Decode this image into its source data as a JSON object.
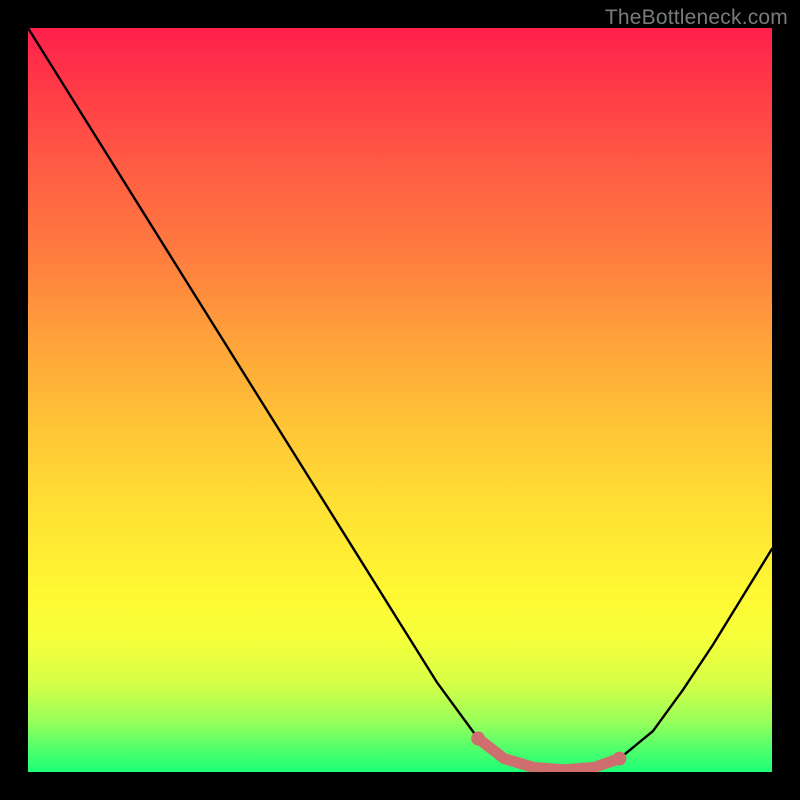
{
  "watermark": "TheBottleneck.com",
  "chart_data": {
    "type": "line",
    "title": "",
    "xlabel": "",
    "ylabel": "",
    "xlim": [
      0,
      100
    ],
    "ylim": [
      0,
      100
    ],
    "grid": false,
    "series": [
      {
        "name": "bottleneck-curve",
        "x": [
          0,
          5,
          10,
          15,
          20,
          25,
          30,
          35,
          40,
          45,
          50,
          55,
          60.5,
          64,
          68,
          72,
          76,
          79.5,
          84,
          88,
          92,
          96,
          100
        ],
        "values": [
          100,
          92,
          84,
          76,
          68,
          60,
          52,
          44,
          36,
          28,
          20,
          12,
          4.5,
          1.8,
          0.6,
          0.3,
          0.6,
          1.8,
          5.5,
          11,
          17,
          23.5,
          30
        ],
        "color": "#000000"
      },
      {
        "name": "optimal-region-highlight",
        "x": [
          60.5,
          64,
          68,
          72,
          76,
          79.5
        ],
        "values": [
          4.5,
          1.8,
          0.6,
          0.3,
          0.6,
          1.8
        ],
        "color": "#cf6e6e"
      }
    ],
    "highlight_endpoints": [
      {
        "x": 60.5,
        "y": 4.5,
        "color": "#cf6e6e"
      },
      {
        "x": 79.5,
        "y": 1.8,
        "color": "#cf6e6e"
      }
    ],
    "background_gradient": {
      "top": "#ff1f4c",
      "middle": "#ffe433",
      "bottom": "#1cff77"
    }
  }
}
